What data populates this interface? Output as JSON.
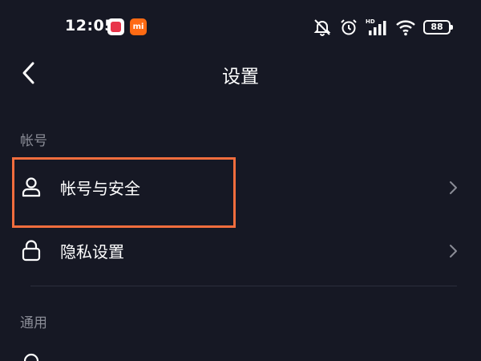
{
  "status_bar": {
    "time": "12:05",
    "app_badge_2": "mi",
    "network_label": "HD",
    "battery_level": "88",
    "icons": [
      "muted-bell-icon",
      "alarm-icon",
      "cellular-signal-icon",
      "wifi-icon",
      "battery-icon"
    ]
  },
  "nav": {
    "back_icon": "chevron-left-icon",
    "title": "设置"
  },
  "sections": [
    {
      "header": "帐号",
      "items": [
        {
          "label": "帐号与安全",
          "icon": "user-icon"
        },
        {
          "label": "隐私设置",
          "icon": "lock-icon"
        }
      ]
    },
    {
      "header": "通用",
      "items": []
    }
  ],
  "colors": {
    "background": "#161824",
    "text": "#ffffff",
    "section_header": "#8a8c96",
    "highlight": "#f26d3d",
    "divider": "#2b2e3c"
  }
}
